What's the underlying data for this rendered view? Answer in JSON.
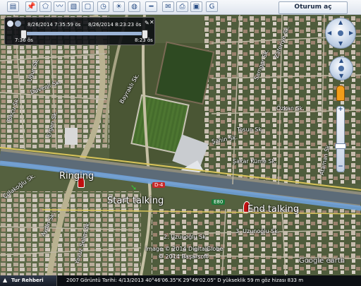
{
  "toolbar": {
    "buttons": [
      "sidebar-toggle-icon",
      "placemark-icon",
      "polygon-icon",
      "path-icon",
      "image-overlay-icon",
      "record-tour-icon",
      "historical-imagery-icon",
      "sunlight-icon",
      "sky-icon",
      "ruler-icon",
      "email-icon",
      "print-icon",
      "save-image-icon",
      "maps-icon"
    ],
    "signin_label": "Oturum aç"
  },
  "time_slider": {
    "range_start": "8/26/2014  7:35:59 ös",
    "range_end": "8/26/2014  8:23:23 ös",
    "left_label": "7:36 ös",
    "right_label": "8:23 ös",
    "start_fraction": 0.0,
    "end_fraction": 1.0
  },
  "map": {
    "markers": {
      "ringing": "Ringing",
      "start_talking": "Start talking",
      "end_talking": "End talking"
    },
    "road_shields": {
      "d4": "D-4",
      "e80": "E80"
    },
    "streets": [
      "Uğur Sk.",
      "Düvenli Sk.",
      "Bayraklı Sk.",
      "Tokçu Sk.",
      "Ergen Sk.",
      "Zaferiye Sk.",
      "Samgar Sk.",
      "Özkan Sk.",
      "Tosun Sk.",
      "Şahin Sk.",
      "Kale Sk.",
      "Aydın Sk.",
      "Tel Sk.",
      "Rustu Gözu Sk.",
      "Turan Sk.",
      "Şakar Küme Sk.",
      "Ataman Sk.",
      "Çolakoğlu Sk.",
      "2. Uzunoğlu Sk.",
      "3. Uzunoğlu Sk.",
      "Yavuz Selim Sk."
    ],
    "attribution": {
      "line1": "Image © 2014 DigitalGlobe",
      "line2": "© 2014 Başarsoft",
      "logo": "Google earth"
    }
  },
  "status_bar": {
    "tour_guide_label": "Tur Rehberi",
    "details": "2007 Görüntü Tarihi: 4/13/2013    40°46'06.35\"K  29°49'02.05\" D yükseklik   59 m     göz hizası   833 m"
  }
}
